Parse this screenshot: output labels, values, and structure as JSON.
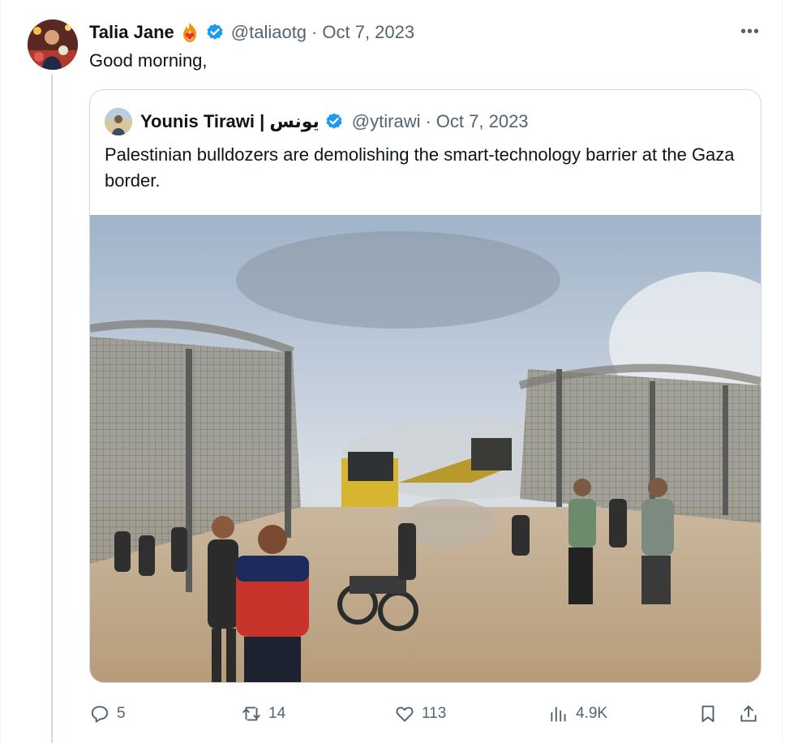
{
  "tweet": {
    "author_name": "Talia Jane",
    "author_handle": "@taliaotg",
    "separator": "·",
    "date": "Oct 7, 2023",
    "text": "Good morning,",
    "more_label": "•••",
    "avatar_icon": "avatar-photo",
    "emoji_icon": "fire-heart-emoji",
    "verified_color": "#1d9bf0"
  },
  "quoted_tweet": {
    "author_name": "Younis Tirawi | يونس",
    "author_handle": "@ytirawi",
    "separator": "·",
    "date": "Oct 7, 2023",
    "text": "Palestinian bulldozers are demolishing the smart-technology barrier at the Gaza border.",
    "media": "photo"
  },
  "actions": {
    "replies": "5",
    "reposts": "14",
    "likes": "113",
    "views": "4.9K"
  },
  "colors": {
    "text": "#0f1419",
    "secondary": "#536471",
    "border": "#cfd9de",
    "accent": "#1d9bf0"
  }
}
